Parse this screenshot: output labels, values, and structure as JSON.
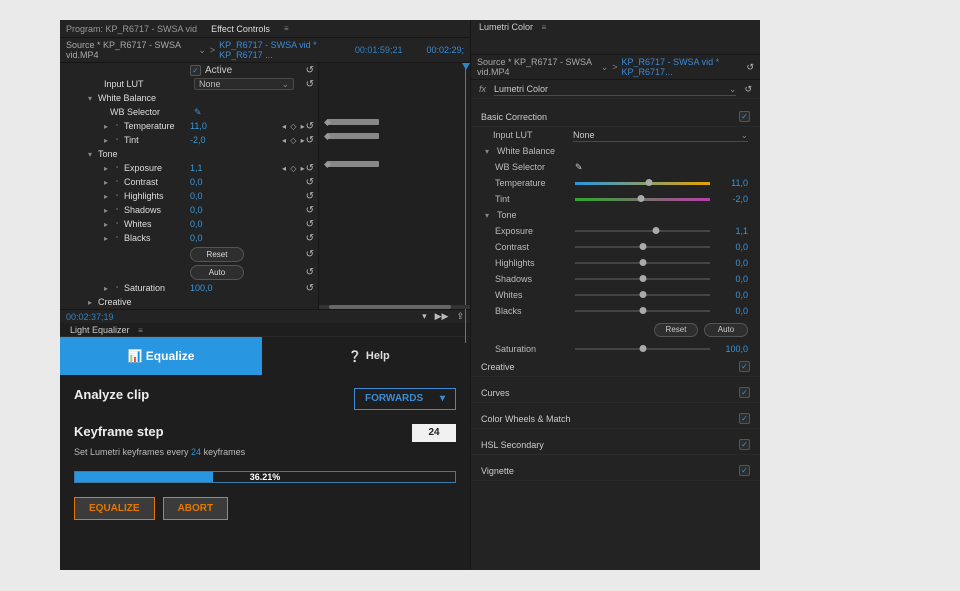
{
  "left_tabs": {
    "program": "Program: KP_R6717 - SWSA vid",
    "effect": "Effect Controls"
  },
  "src_master": "Source * KP_R6717 - SWSA vid.MP4",
  "src_clip": "KP_R6717 - SWSA vid * KP_R6717 ...",
  "time_a": "00:01:59;21",
  "time_b": "00:02:29;",
  "active_label": "Active",
  "params": {
    "inputLUT": {
      "label": "Input LUT",
      "value": "None"
    },
    "whiteBalance": "White Balance",
    "wbSelector": "WB Selector",
    "temperature": {
      "label": "Temperature",
      "value": "11,0"
    },
    "tint": {
      "label": "Tint",
      "value": "-2,0"
    },
    "tone": "Tone",
    "exposure": {
      "label": "Exposure",
      "value": "1,1"
    },
    "contrast": {
      "label": "Contrast",
      "value": "0,0"
    },
    "highlights": {
      "label": "Highlights",
      "value": "0,0"
    },
    "shadows": {
      "label": "Shadows",
      "value": "0,0"
    },
    "whites": {
      "label": "Whites",
      "value": "0,0"
    },
    "blacks": {
      "label": "Blacks",
      "value": "0,0"
    },
    "reset": "Reset",
    "auto": "Auto",
    "saturation": {
      "label": "Saturation",
      "value": "100,0"
    },
    "creative": "Creative"
  },
  "timecode": "00:02:37;19",
  "lighteq": {
    "title": "Light Equalizer",
    "equalize": "Equalize",
    "help": "Help",
    "analyze": "Analyze clip",
    "forwards": "FORWARDS",
    "kfstep": "Keyframe step",
    "kfhint_a": "Set Lumetri keyframes every ",
    "kfhint_n": "24",
    "kfhint_b": " keyframes",
    "stepval": "24",
    "pct": "36.21%",
    "equalizeBtn": "EQUALIZE",
    "abort": "ABORT"
  },
  "progress_pct": 36.21,
  "right": {
    "title": "Lumetri Color",
    "srcline": "Source * KP_R6717 - SWSA vid.MP4",
    "srcclip": "KP_R6717 - SWSA vid * KP_R6717...",
    "effect": "Lumetri Color",
    "basic": "Basic Correction",
    "inputLUT": {
      "label": "Input LUT",
      "value": "None"
    },
    "whiteBalance": "White Balance",
    "wbSelector": "WB Selector",
    "temperature": {
      "label": "Temperature",
      "value": "11,0"
    },
    "tint": {
      "label": "Tint",
      "value": "-2,0"
    },
    "tone": "Tone",
    "exposure": {
      "label": "Exposure",
      "value": "1,1"
    },
    "contrast": {
      "label": "Contrast",
      "value": "0,0"
    },
    "highlights": {
      "label": "Highlights",
      "value": "0,0"
    },
    "shadows": {
      "label": "Shadows",
      "value": "0,0"
    },
    "whites": {
      "label": "Whites",
      "value": "0,0"
    },
    "blacks": {
      "label": "Blacks",
      "value": "0,0"
    },
    "reset": "Reset",
    "auto": "Auto",
    "saturation": {
      "label": "Saturation",
      "value": "100,0"
    },
    "creative": "Creative",
    "curves": "Curves",
    "colorwheels": "Color Wheels & Match",
    "hsl": "HSL Secondary",
    "vignette": "Vignette"
  }
}
